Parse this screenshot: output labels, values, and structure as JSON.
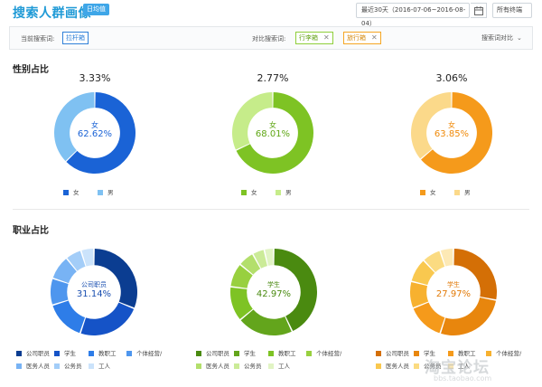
{
  "header": {
    "title": "搜索人群画像",
    "badge": "日均值",
    "date_range": "最近30天（2016-07-06~2016-08-04）",
    "terminal": "所有终端"
  },
  "filter": {
    "current_label": "当前搜索词:",
    "current_term": "拉杆箱",
    "compare_label": "对比搜索词:",
    "compare_terms": [
      "行李箱",
      "旅行箱"
    ],
    "contrast_button": "搜索词对比"
  },
  "gender_section": {
    "title": "性别占比",
    "center_label": "女",
    "legend": [
      "女",
      "男"
    ],
    "charts": [
      {
        "top_pct": "3.33%",
        "female": 62.62,
        "female_text": "62.62%",
        "colors": [
          "#1a63d6",
          "#7fc1f2"
        ],
        "text_color": "#1a63d6"
      },
      {
        "top_pct": "2.77%",
        "female": 68.01,
        "female_text": "68.01%",
        "colors": [
          "#7ec324",
          "#c6ec8a"
        ],
        "text_color": "#5fa614"
      },
      {
        "top_pct": "3.06%",
        "female": 63.85,
        "female_text": "63.85%",
        "colors": [
          "#f59a1b",
          "#fbd98a"
        ],
        "text_color": "#f08a0a"
      }
    ]
  },
  "job_section": {
    "title": "职业占比",
    "legend": [
      "公司职员",
      "学生",
      "教职工",
      "个体经营/",
      "医务人员",
      "公务员",
      "工人"
    ],
    "charts": [
      {
        "center_label": "公司职员",
        "center_text": "31.14%",
        "text_color": "#1a4fb0",
        "values": [
          31.14,
          24,
          15,
          10,
          9,
          6,
          4.86
        ],
        "colors": [
          "#0b3d91",
          "#1553c7",
          "#2e7de8",
          "#4e96ee",
          "#78b3f4",
          "#a3cdf8",
          "#cbe3fb"
        ]
      },
      {
        "center_label": "学生",
        "center_text": "42.97%",
        "text_color": "#4a8a10",
        "values": [
          42.97,
          21,
          13,
          9,
          6,
          4.5,
          3.53
        ],
        "colors": [
          "#4a8a10",
          "#63a51c",
          "#7ec324",
          "#98d03f",
          "#b3df6c",
          "#cbeb98",
          "#e1f4c4"
        ]
      },
      {
        "center_label": "学生",
        "center_text": "27.97%",
        "text_color": "#e27a08",
        "values": [
          27.97,
          27,
          14,
          10,
          9,
          7,
          5.03
        ],
        "colors": [
          "#d46f06",
          "#e8860d",
          "#f59a1b",
          "#f7b12f",
          "#f9c84f",
          "#fbdb81",
          "#fde9b5"
        ]
      }
    ]
  },
  "watermark": {
    "text": "淘宝论坛",
    "url": "bbs.taobao.com"
  }
}
